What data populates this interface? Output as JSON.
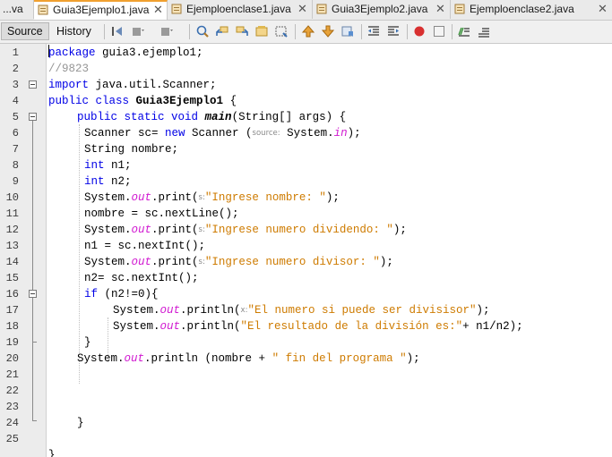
{
  "tabs": [
    {
      "label": "...va",
      "icon": "none",
      "active": false
    },
    {
      "label": "Guia3Ejemplo1.java",
      "icon": "java-file-icon",
      "active": true
    },
    {
      "label": "Ejemploenclase1.java",
      "icon": "java-file-icon",
      "active": false
    },
    {
      "label": "Guia3Ejemplo2.java",
      "icon": "java-file-icon",
      "active": false
    },
    {
      "label": "Ejemploenclase2.java",
      "icon": "java-file-icon",
      "active": false
    }
  ],
  "tab_close_glyph": "✕",
  "toolbar": {
    "source_label": "Source",
    "history_label": "History",
    "icons": [
      "last-edit-icon",
      "back-icon",
      "forward-icon",
      "find-icon",
      "find-previous-icon",
      "find-next-icon",
      "toggle-highlight-icon",
      "find-selection-icon",
      "previous-bookmark-icon",
      "next-bookmark-icon",
      "toggle-bookmark-icon",
      "shift-left-icon",
      "shift-right-icon",
      "start-macro-icon",
      "stop-macro-icon",
      "comment-icon",
      "uncomment-icon"
    ]
  },
  "line_numbers": [
    "1",
    "2",
    "3",
    "4",
    "5",
    "6",
    "7",
    "8",
    "9",
    "10",
    "11",
    "12",
    "13",
    "14",
    "15",
    "16",
    "17",
    "18",
    "19",
    "20",
    "21",
    "22",
    "23",
    "24",
    "25"
  ],
  "code": {
    "l1_kw": "package",
    "l1_rest": " guia3.ejemplo1;",
    "l2": "//9823",
    "l3_kw": "import",
    "l3_rest": " java.util.Scanner;",
    "l4_kw": "public class",
    "l4_name": "Guia3Ejemplo1",
    "l4_rest": " {",
    "l5_kw": "public static void",
    "l5_name": "main",
    "l5_rest": "(String[] args) {",
    "l6_a": "Scanner sc= ",
    "l6_kw": "new",
    "l6_b": " Scanner (",
    "l6_hint": "source:",
    "l6_c": " System.",
    "l6_fld": "in",
    "l6_d": ");",
    "l7": "String nombre;",
    "l8_kw": "int",
    "l8_rest": " n1;",
    "l9_kw": "int",
    "l9_rest": " n2;",
    "l10_a": "System.",
    "l10_out": "out",
    "l10_b": ".print(",
    "l10_hint": "s:",
    "l10_str": "\"Ingrese nombre: \"",
    "l10_c": ");",
    "l11": "nombre = sc.nextLine();",
    "l12_a": "System.",
    "l12_out": "out",
    "l12_b": ".print(",
    "l12_hint": "s:",
    "l12_str": "\"Ingrese numero dividendo: \"",
    "l12_c": ");",
    "l13": "n1 = sc.nextInt();",
    "l14_a": "System.",
    "l14_out": "out",
    "l14_b": ".print(",
    "l14_hint": "s:",
    "l14_str": "\"Ingrese numero divisor: \"",
    "l14_c": ");",
    "l15": "n2= sc.nextInt();",
    "l16_kw": "if",
    "l16_rest": " (n2!=0){",
    "l17_a": "System.",
    "l17_out": "out",
    "l17_b": ".println(",
    "l17_hint": "x:",
    "l17_str": "\"El numero si puede ser divisisor\"",
    "l17_c": ");",
    "l18_a": "System.",
    "l18_out": "out",
    "l18_b": ".println(",
    "l18_str": "\"El resultado de la división es:\"",
    "l18_c": "+ n1/n2);",
    "l19": "}",
    "l20_a": "System.",
    "l20_out": "out",
    "l20_b": ".println (nombre + ",
    "l20_str": "\" fin del programa \"",
    "l20_c": ");",
    "l24": "}",
    "l26": "}"
  },
  "colors": {
    "keyword": "#0000e6",
    "comment": "#969696",
    "string": "#ce7b00",
    "static_field": "#d11ad1",
    "active_tab_accent": "#f0a030"
  }
}
